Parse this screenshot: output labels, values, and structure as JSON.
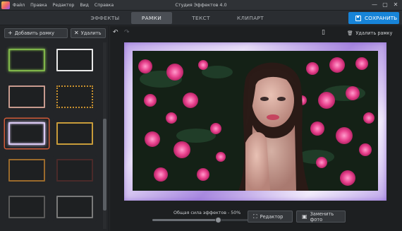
{
  "window": {
    "title": "Студия Эффектов 4.0",
    "menu": [
      "Файл",
      "Правка",
      "Редактор",
      "Вид",
      "Справка"
    ],
    "controls": {
      "minimize": "—",
      "maximize": "▢",
      "close": "✕"
    }
  },
  "toolbar": {
    "tabs": [
      {
        "label": "ЭФФЕКТЫ",
        "active": false
      },
      {
        "label": "РАМКИ",
        "active": true
      },
      {
        "label": "ТЕКСТ",
        "active": false
      },
      {
        "label": "КЛИПАРТ",
        "active": false
      }
    ],
    "save_label": "СОХРАНИТЬ",
    "save_icon": "floppy-icon",
    "accent": "#1784d8"
  },
  "left_panel": {
    "add_label": "Добавить рамку",
    "add_icon": "+",
    "delete_label": "Удалить",
    "delete_icon": "✕",
    "frames": [
      {
        "color": "#7fb54a",
        "style": "glow",
        "selected": false
      },
      {
        "color": "#e9e9e9",
        "style": "solid",
        "selected": false
      },
      {
        "color": "#c79a8e",
        "style": "solid",
        "selected": false
      },
      {
        "color": "#c9912f",
        "style": "ornate",
        "selected": false
      },
      {
        "color": "#d9c9f2",
        "style": "glow",
        "selected": true
      },
      {
        "color": "#c79b3a",
        "style": "solid",
        "selected": false
      },
      {
        "color": "#9a6a2c",
        "style": "solid",
        "selected": false
      },
      {
        "color": "#4a2a2a",
        "style": "solid",
        "selected": false
      },
      {
        "color": "#5a5a5a",
        "style": "solid",
        "selected": false
      },
      {
        "color": "#7a7a7a",
        "style": "solid",
        "selected": false
      }
    ],
    "selection_color": "#d05a38"
  },
  "editor": {
    "undo_icon": "↶",
    "redo_icon": "↷",
    "compare_icon": "▯",
    "delete_frame_icon": "🗑",
    "delete_frame_label": "Удалить рамку",
    "canvas_frame_color": "#c7b2ef"
  },
  "bottom": {
    "strength_label": "Общая сила эффектов - 50%",
    "strength_value": 0.5,
    "editor_label": "Редактор",
    "editor_icon": "crop-icon",
    "replace_label": "Заменить фото",
    "replace_icon": "image-icon"
  }
}
